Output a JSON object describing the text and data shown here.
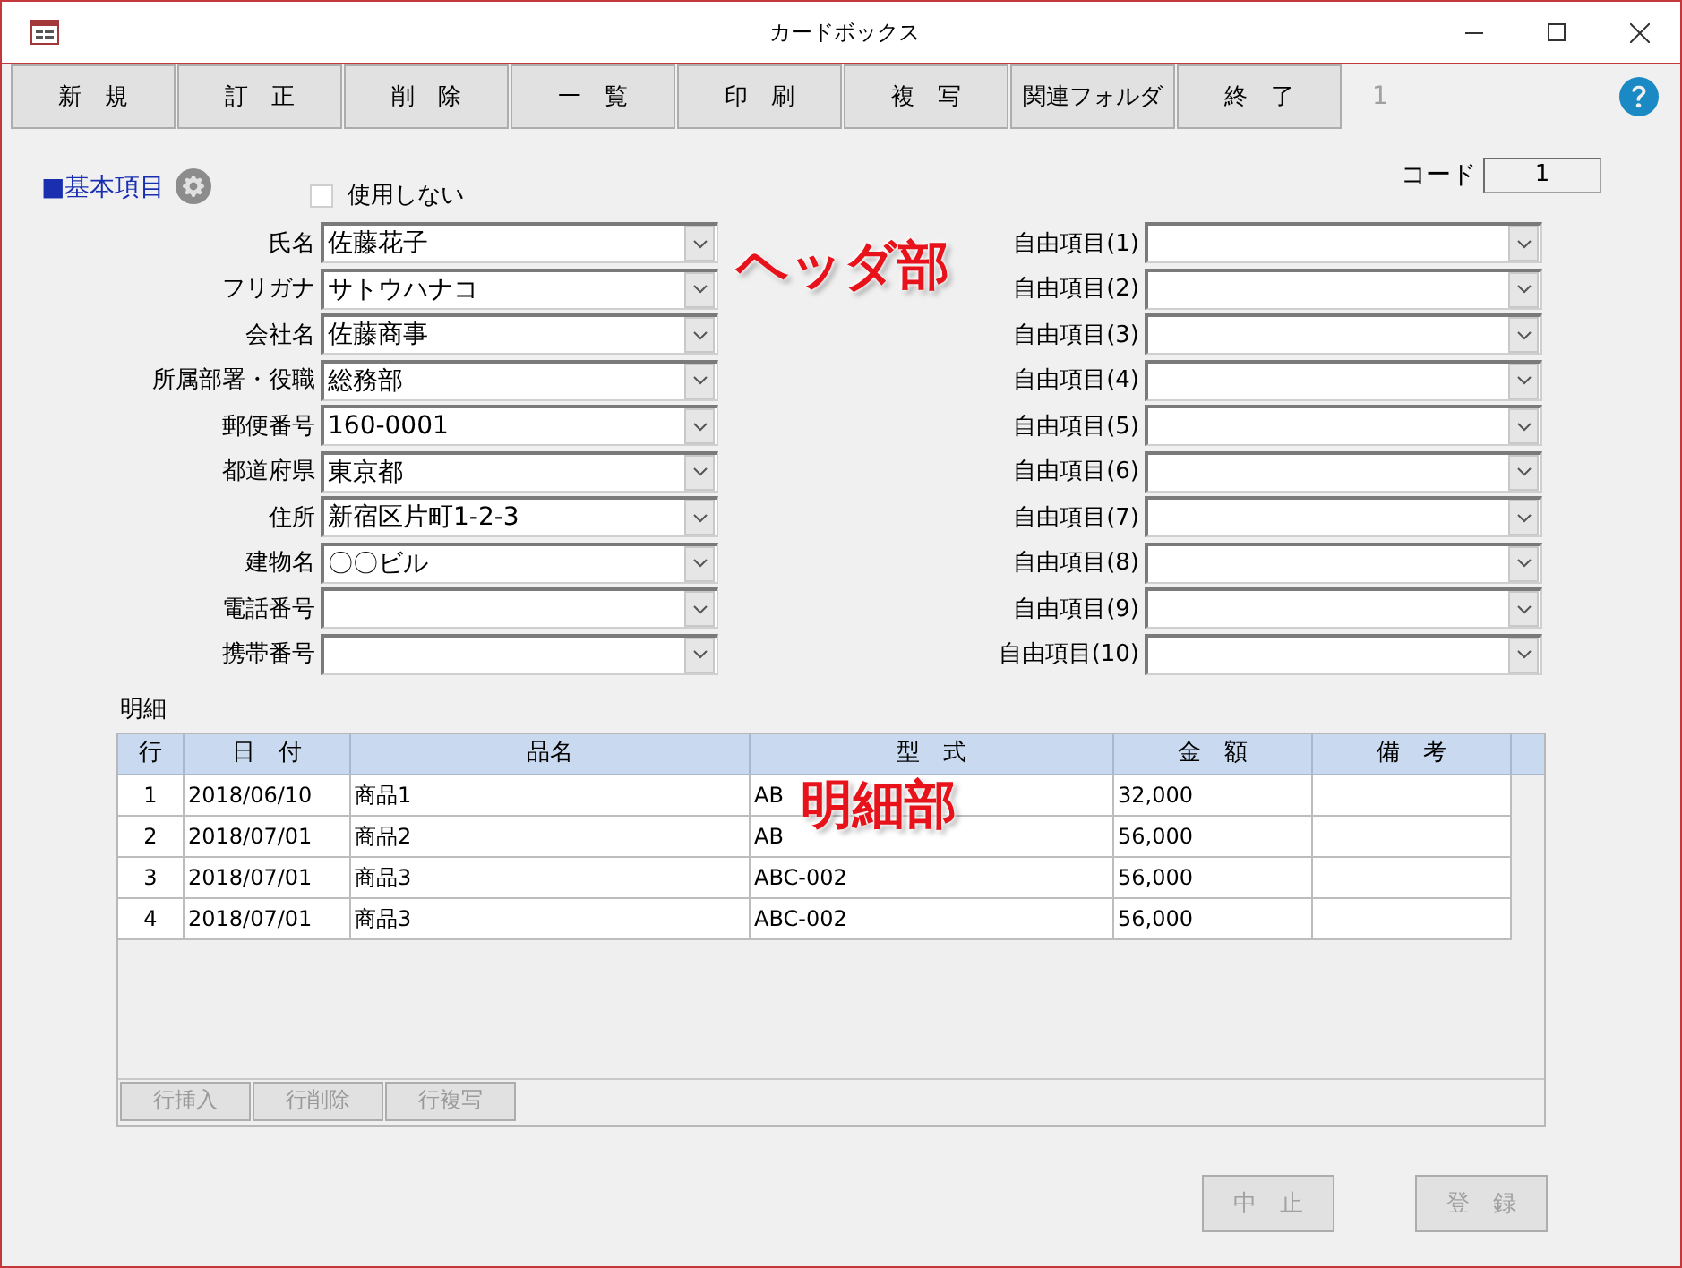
{
  "window": {
    "title": "カードボックス"
  },
  "toolbar": [
    {
      "label": "新　規"
    },
    {
      "label": "訂　正"
    },
    {
      "label": "削　除"
    },
    {
      "label": "一　覧"
    },
    {
      "label": "印　刷"
    },
    {
      "label": "複　写"
    },
    {
      "label": "関連フォルダ"
    },
    {
      "label": "終　了"
    }
  ],
  "record_counter": "1",
  "section": {
    "title": "■基本項目",
    "unused_checkbox": {
      "label": "使用しない",
      "checked": false,
      "disabled": true
    }
  },
  "code": {
    "label": "コード",
    "value": "1"
  },
  "left_fields": [
    {
      "label": "氏名",
      "value": "佐藤花子"
    },
    {
      "label": "フリガナ",
      "value": "サトウハナコ"
    },
    {
      "label": "会社名",
      "value": "佐藤商事"
    },
    {
      "label": "所属部署・役職",
      "value": "総務部"
    },
    {
      "label": "郵便番号",
      "value": "160-0001"
    },
    {
      "label": "都道府県",
      "value": "東京都"
    },
    {
      "label": "住所",
      "value": "新宿区片町1-2-3"
    },
    {
      "label": "建物名",
      "value": "〇〇ビル"
    },
    {
      "label": "電話番号"
    },
    {
      "label": "携帯番号"
    }
  ],
  "right_fields": [
    {
      "label": "自由項目(1)"
    },
    {
      "label": "自由項目(2)"
    },
    {
      "label": "自由項目(3)"
    },
    {
      "label": "自由項目(4)"
    },
    {
      "label": "自由項目(5)"
    },
    {
      "label": "自由項目(6)"
    },
    {
      "label": "自由項目(7)"
    },
    {
      "label": "自由項目(8)"
    },
    {
      "label": "自由項目(9)"
    },
    {
      "label": "自由項目(10)"
    }
  ],
  "annotations": [
    {
      "text": "ヘッダ部"
    },
    {
      "text": "明細部"
    }
  ],
  "detail": {
    "title": "明細",
    "columns": [
      "行",
      "日　付",
      "品名",
      "型　式",
      "金　額",
      "備　考"
    ],
    "rows": [
      [
        "1",
        "2018/06/10",
        "商品1",
        "AB",
        "32,000",
        ""
      ],
      [
        "2",
        "2018/07/01",
        "商品2",
        "AB",
        "56,000",
        ""
      ],
      [
        "3",
        "2018/07/01",
        "商品3",
        "ABC-002",
        "56,000",
        ""
      ],
      [
        "4",
        "2018/07/01",
        "商品3",
        "ABC-002",
        "56,000",
        ""
      ]
    ],
    "row_buttons": [
      {
        "label": "行挿入",
        "disabled": true
      },
      {
        "label": "行削除",
        "disabled": true
      },
      {
        "label": "行複写",
        "disabled": true
      }
    ]
  },
  "actions": [
    {
      "label": "中　止",
      "disabled": true
    },
    {
      "label": "登　録",
      "disabled": true
    }
  ]
}
